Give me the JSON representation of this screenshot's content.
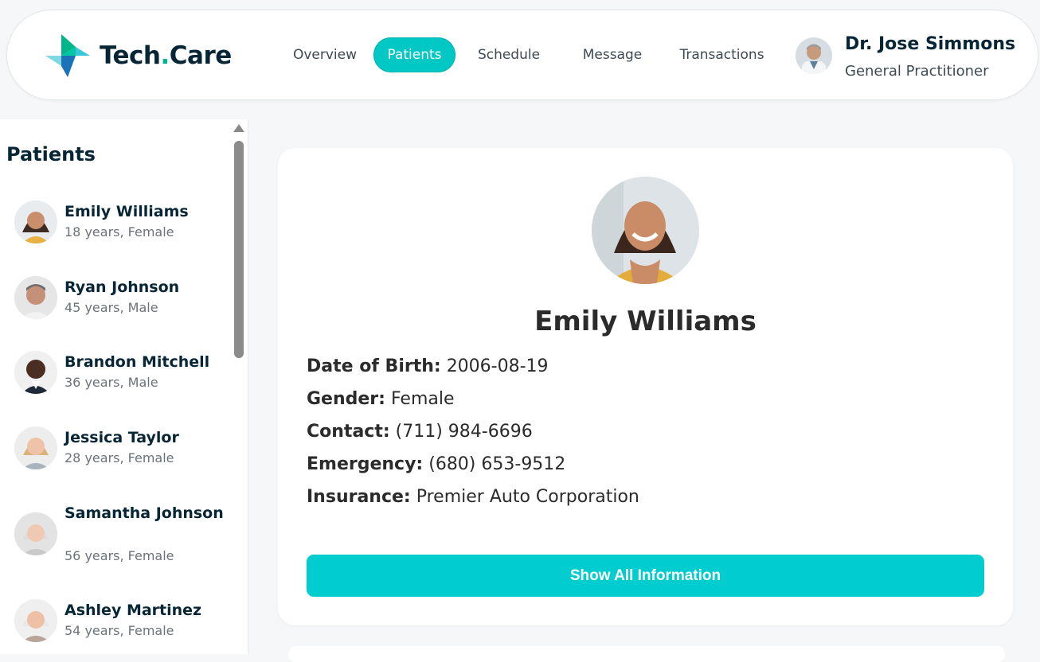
{
  "brand": {
    "name_part1": "Tech",
    "name_dot": ".",
    "name_part2": "Care"
  },
  "nav": {
    "items": [
      {
        "label": "Overview",
        "active": false
      },
      {
        "label": "Patients",
        "active": true
      },
      {
        "label": "Schedule",
        "active": false
      },
      {
        "label": "Message",
        "active": false
      },
      {
        "label": "Transactions",
        "active": false
      }
    ]
  },
  "doctor": {
    "name": "Dr. Jose Simmons",
    "role": "General Practitioner"
  },
  "sidebar": {
    "title": "Patients",
    "patients": [
      {
        "name": "Emily Williams",
        "meta": "18 years, Female"
      },
      {
        "name": "Ryan Johnson",
        "meta": "45 years, Male"
      },
      {
        "name": "Brandon Mitchell",
        "meta": "36 years, Male"
      },
      {
        "name": "Jessica Taylor",
        "meta": "28 years, Female"
      },
      {
        "name": "Samantha Johnson",
        "meta": "56 years, Female"
      },
      {
        "name": "Ashley Martinez",
        "meta": "54 years, Female"
      }
    ]
  },
  "profile": {
    "name": "Emily Williams",
    "fields": [
      {
        "label": "Date of Birth:",
        "value": "2006-08-19"
      },
      {
        "label": "Gender:",
        "value": "Female"
      },
      {
        "label": "Contact:",
        "value": "(711) 984-6696"
      },
      {
        "label": "Emergency:",
        "value": "(680) 653-9512"
      },
      {
        "label": "Insurance:",
        "value": "Premier Auto Corporation"
      }
    ],
    "button_label": "Show All Information"
  },
  "colors": {
    "accent": "#01c7c5",
    "button": "#01cdd0",
    "brand_dark": "#072635",
    "brand_green": "#01b58a"
  }
}
